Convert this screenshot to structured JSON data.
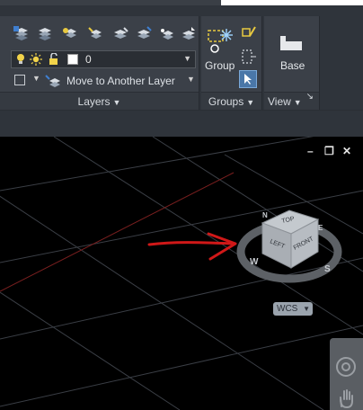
{
  "ribbon": {
    "layers_panel": {
      "title": "Layers",
      "layer_combo_value": "0",
      "move_button_label": "Move to Another Layer",
      "tool_icons": [
        "layer-properties-icon",
        "layer-isolate-icon",
        "layer-off-icon",
        "layer-freeze-icon",
        "layer-lock-icon",
        "layer-unisolate-icon",
        "layer-thaw-icon",
        "layer-match-icon"
      ]
    },
    "groups_panel": {
      "title": "Groups",
      "group_button_label": "Group"
    },
    "view_panel": {
      "title": "View",
      "base_button_label": "Base"
    }
  },
  "viewport": {
    "controls": {
      "minimize": "–",
      "restore": "❐",
      "close": "✕"
    },
    "viewcube": {
      "face_top": "TOP",
      "face_left": "LEFT",
      "face_front": "FRONT",
      "compass_n": "N",
      "compass_e": "E",
      "compass_s": "S",
      "compass_w": "W"
    },
    "wcs_label": "WCS"
  },
  "colors": {
    "ribbon_bg": "#2f343b",
    "panel_bg": "#3b4048",
    "viewport_bg": "#000000",
    "grid_line": "#3a3e45",
    "axis_red": "#7a1f1f",
    "annotation_arrow": "#d01818",
    "viewcube_gray": "#b9bec4"
  }
}
